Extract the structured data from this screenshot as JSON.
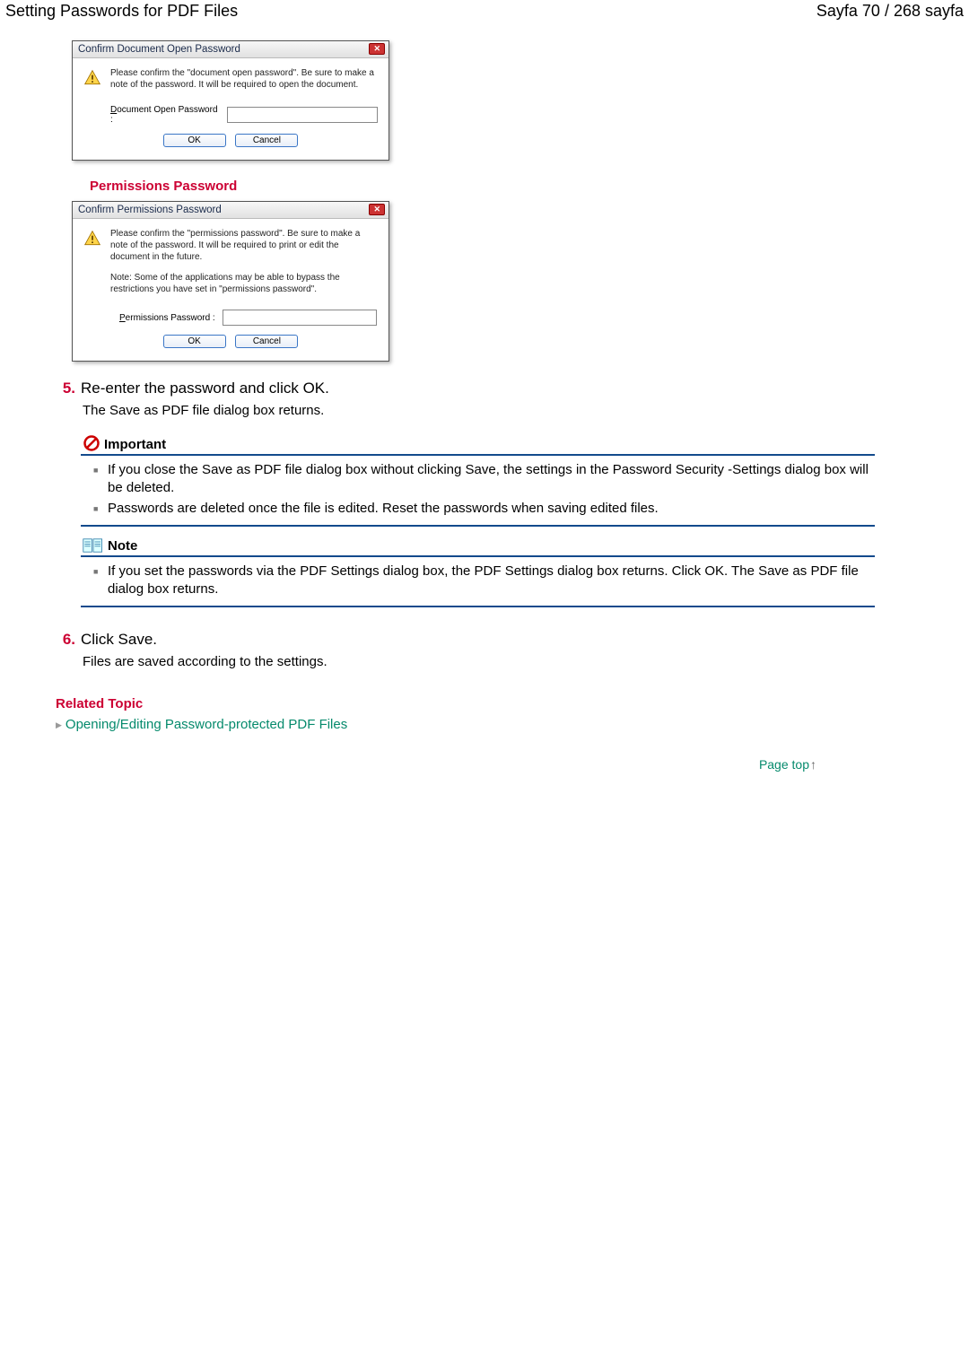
{
  "header": {
    "title": "Setting Passwords for PDF Files",
    "page_indicator": "Sayfa 70 / 268 sayfa"
  },
  "dialog_open": {
    "title": "Confirm Document Open Password",
    "message": "Please confirm the \"document open password\". Be sure to make a note of the password. It will be required to open the document.",
    "field_label_pre": "D",
    "field_label_rest": "ocument Open Password :",
    "ok": "OK",
    "cancel": "Cancel"
  },
  "perm_heading": "Permissions Password",
  "dialog_perm": {
    "title": "Confirm Permissions Password",
    "message": "Please confirm the \"permissions password\". Be sure to make a note of the password. It will be required to print or edit the document in the future.",
    "note": "Note: Some of the applications may be able to bypass the restrictions you have set in \"permissions password\".",
    "field_label_pre": "P",
    "field_label_rest": "ermissions Password :",
    "ok": "OK",
    "cancel": "Cancel"
  },
  "steps": {
    "s5_num": "5.",
    "s5_text": "Re-enter the password and click OK.",
    "s5_sub": "The Save as PDF file dialog box returns.",
    "s6_num": "6.",
    "s6_text": "Click Save.",
    "s6_sub": "Files are saved according to the settings."
  },
  "important": {
    "label": "Important",
    "items": [
      "If you close the Save as PDF file dialog box without clicking Save, the settings in the Password Security -Settings dialog box will be deleted.",
      "Passwords are deleted once the file is edited. Reset the passwords when saving edited files."
    ]
  },
  "note": {
    "label": "Note",
    "items": [
      "If you set the passwords via the PDF Settings dialog box, the PDF Settings dialog box returns. Click OK. The Save as PDF file dialog box returns."
    ]
  },
  "related": {
    "heading": "Related Topic",
    "link": "Opening/Editing Password-protected PDF Files"
  },
  "page_top": "Page top"
}
